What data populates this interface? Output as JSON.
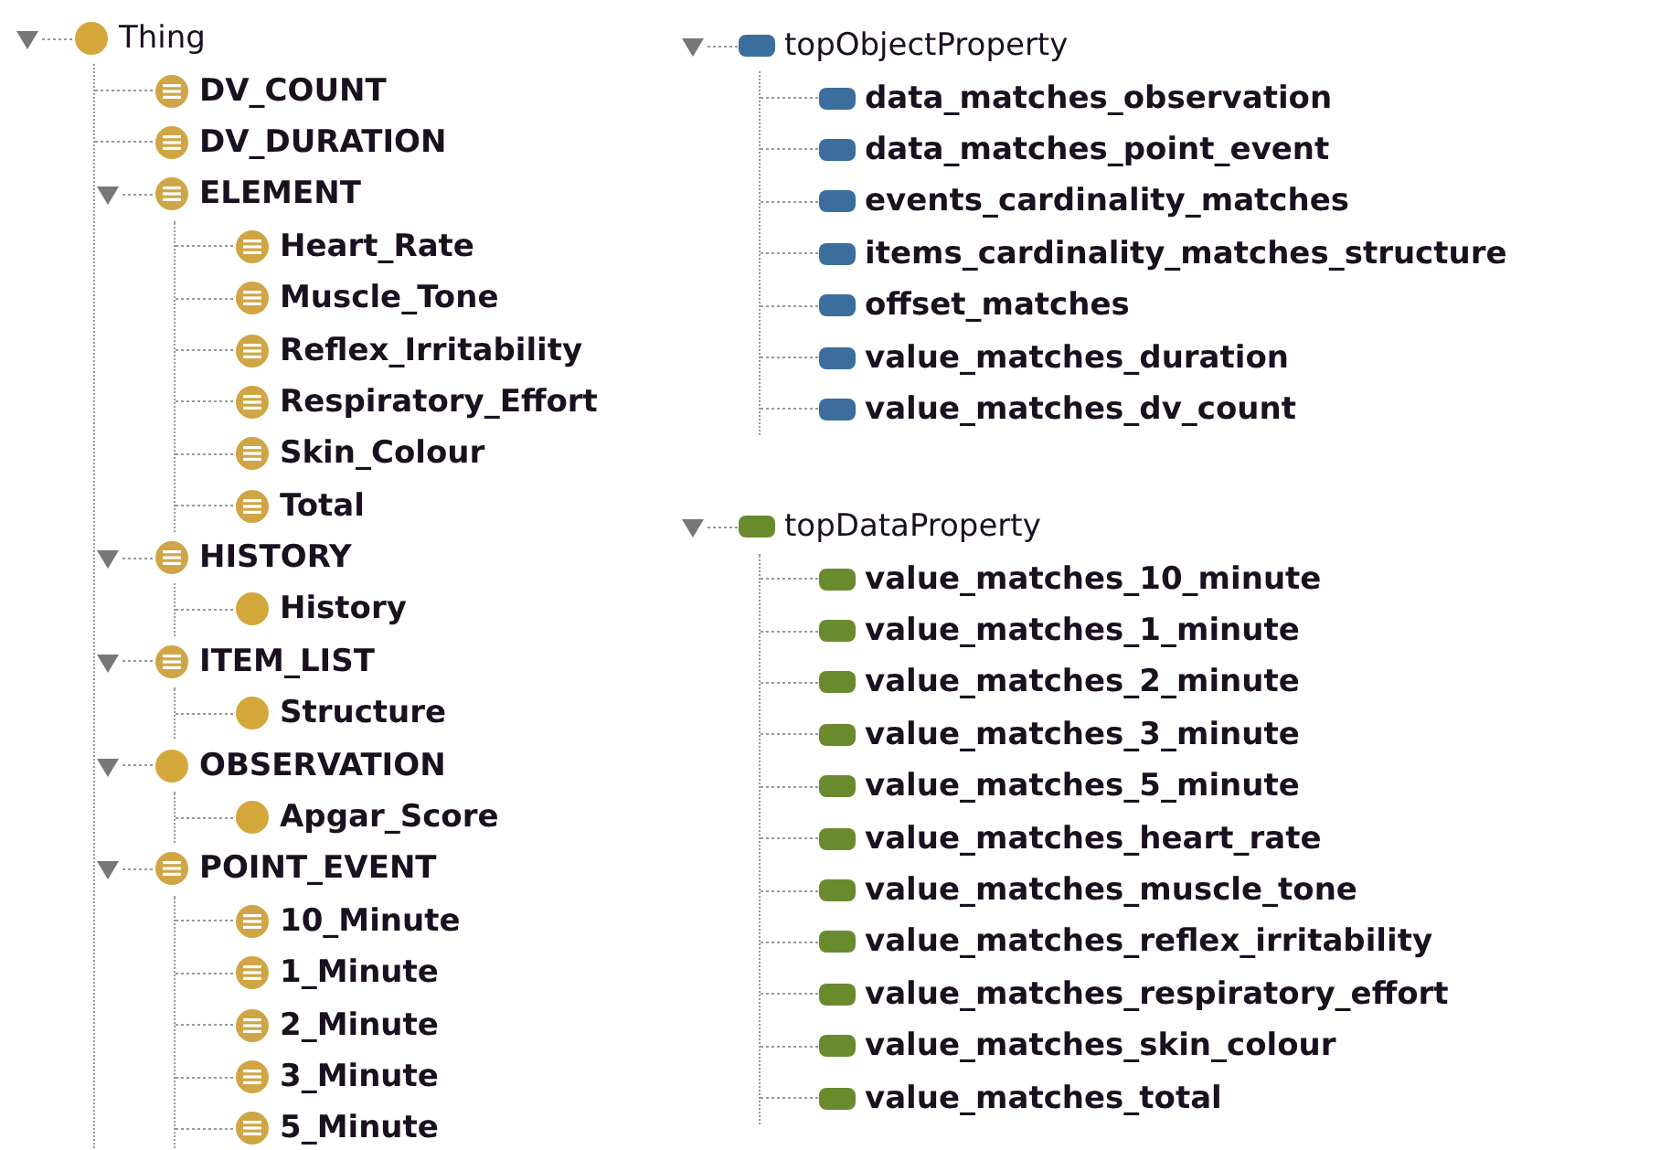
{
  "class_tree": {
    "nodes": [
      {
        "label": "Thing",
        "kind": "class",
        "expanded": true,
        "children": [
          {
            "label": "DV_COUNT",
            "kind": "defined_class"
          },
          {
            "label": "DV_DURATION",
            "kind": "defined_class"
          },
          {
            "label": "ELEMENT",
            "kind": "defined_class",
            "expanded": true,
            "children": [
              {
                "label": "Heart_Rate",
                "kind": "defined_class"
              },
              {
                "label": "Muscle_Tone",
                "kind": "defined_class"
              },
              {
                "label": "Reflex_Irritability",
                "kind": "defined_class"
              },
              {
                "label": "Respiratory_Effort",
                "kind": "defined_class"
              },
              {
                "label": "Skin_Colour",
                "kind": "defined_class"
              },
              {
                "label": "Total",
                "kind": "defined_class"
              }
            ]
          },
          {
            "label": "HISTORY",
            "kind": "defined_class",
            "expanded": true,
            "children": [
              {
                "label": "History",
                "kind": "class"
              }
            ]
          },
          {
            "label": "ITEM_LIST",
            "kind": "defined_class",
            "expanded": true,
            "children": [
              {
                "label": "Structure",
                "kind": "class"
              }
            ]
          },
          {
            "label": "OBSERVATION",
            "kind": "class",
            "expanded": true,
            "children": [
              {
                "label": "Apgar_Score",
                "kind": "class"
              }
            ]
          },
          {
            "label": "POINT_EVENT",
            "kind": "defined_class",
            "expanded": true,
            "children": [
              {
                "label": "10_Minute",
                "kind": "defined_class"
              },
              {
                "label": "1_Minute",
                "kind": "defined_class"
              },
              {
                "label": "2_Minute",
                "kind": "defined_class"
              },
              {
                "label": "3_Minute",
                "kind": "defined_class"
              },
              {
                "label": "5_Minute",
                "kind": "defined_class"
              }
            ]
          }
        ]
      }
    ]
  },
  "object_property_tree": {
    "nodes": [
      {
        "label": "topObjectProperty",
        "kind": "object_property",
        "expanded": true,
        "children": [
          {
            "label": "data_matches_observation",
            "kind": "object_property"
          },
          {
            "label": "data_matches_point_event",
            "kind": "object_property"
          },
          {
            "label": "events_cardinality_matches",
            "kind": "object_property"
          },
          {
            "label": "items_cardinality_matches_structure",
            "kind": "object_property"
          },
          {
            "label": "offset_matches",
            "kind": "object_property"
          },
          {
            "label": "value_matches_duration",
            "kind": "object_property"
          },
          {
            "label": "value_matches_dv_count",
            "kind": "object_property"
          }
        ]
      }
    ]
  },
  "data_property_tree": {
    "nodes": [
      {
        "label": "topDataProperty",
        "kind": "data_property",
        "expanded": true,
        "children": [
          {
            "label": "value_matches_10_minute",
            "kind": "data_property"
          },
          {
            "label": "value_matches_1_minute",
            "kind": "data_property"
          },
          {
            "label": "value_matches_2_minute",
            "kind": "data_property"
          },
          {
            "label": "value_matches_3_minute",
            "kind": "data_property"
          },
          {
            "label": "value_matches_5_minute",
            "kind": "data_property"
          },
          {
            "label": "value_matches_heart_rate",
            "kind": "data_property"
          },
          {
            "label": "value_matches_muscle_tone",
            "kind": "data_property"
          },
          {
            "label": "value_matches_reflex_irritability",
            "kind": "data_property"
          },
          {
            "label": "value_matches_respiratory_effort",
            "kind": "data_property"
          },
          {
            "label": "value_matches_skin_colour",
            "kind": "data_property"
          },
          {
            "label": "value_matches_total",
            "kind": "data_property"
          }
        ]
      }
    ]
  }
}
